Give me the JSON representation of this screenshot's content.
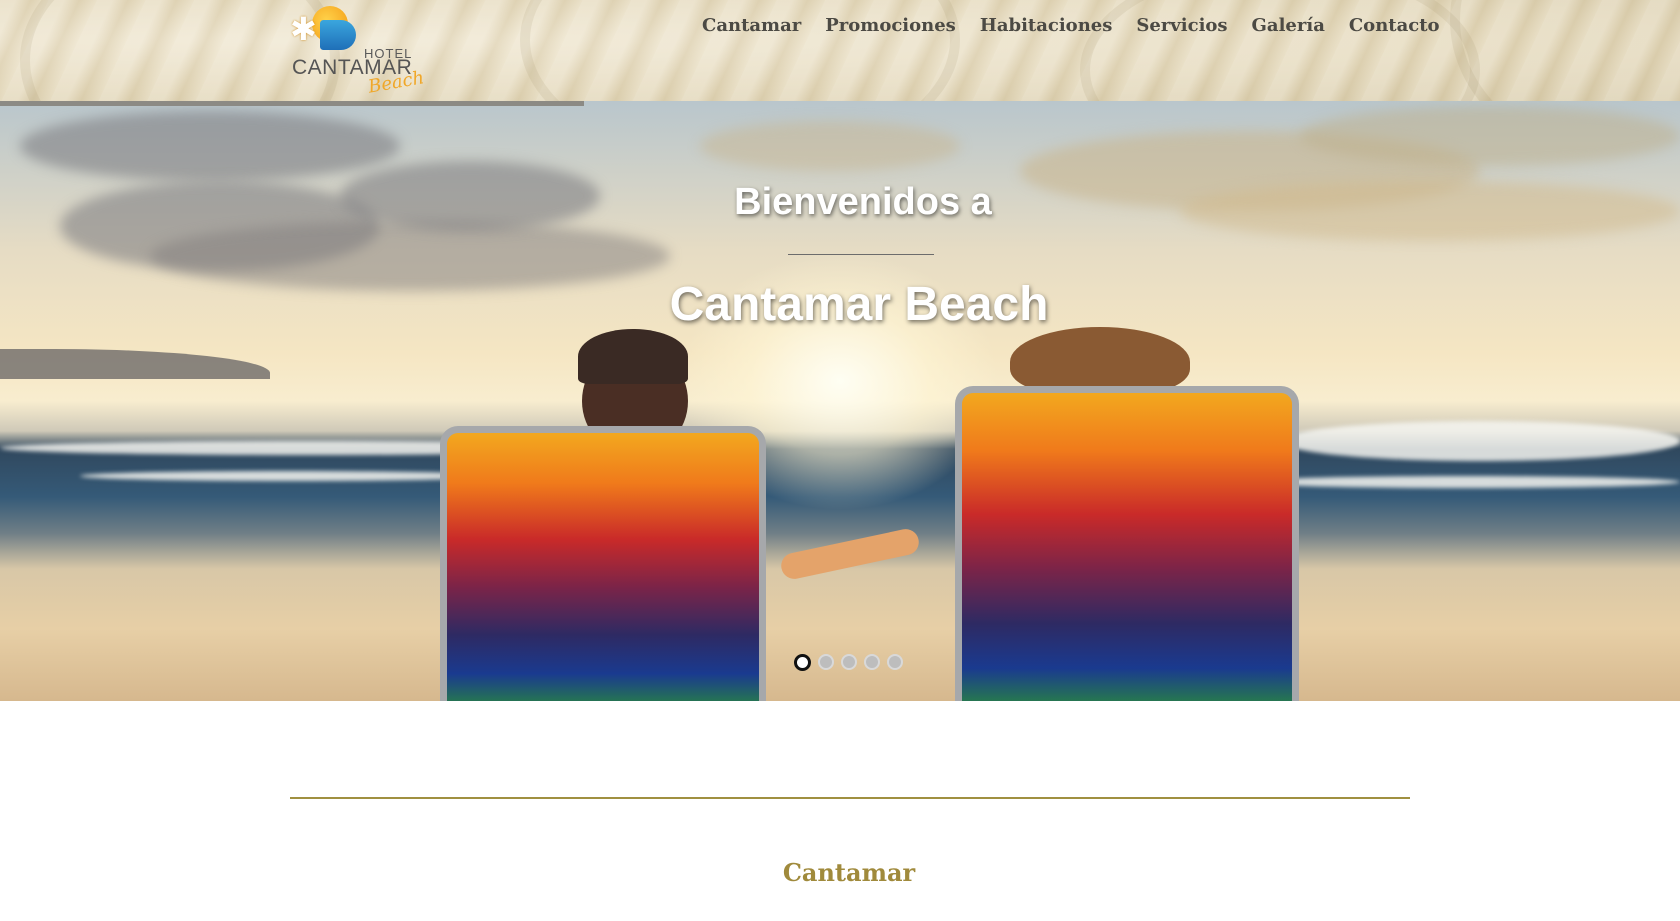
{
  "header": {
    "logo": {
      "hotel": "HOTEL",
      "name": "CANTAMAR",
      "script": "Beach"
    },
    "nav": [
      "Cantamar",
      "Promociones",
      "Habitaciones",
      "Servicios",
      "Galería",
      "Contacto"
    ]
  },
  "hero": {
    "title_line1": "Bienvenidos a",
    "title_line2": "Cantamar Beach",
    "slides_total": 5,
    "active_slide": 1
  },
  "section": {
    "title": "Cantamar"
  },
  "colors": {
    "accent": "#a08a3c",
    "nav_text": "#4c4a44",
    "divider": "#a09040"
  }
}
